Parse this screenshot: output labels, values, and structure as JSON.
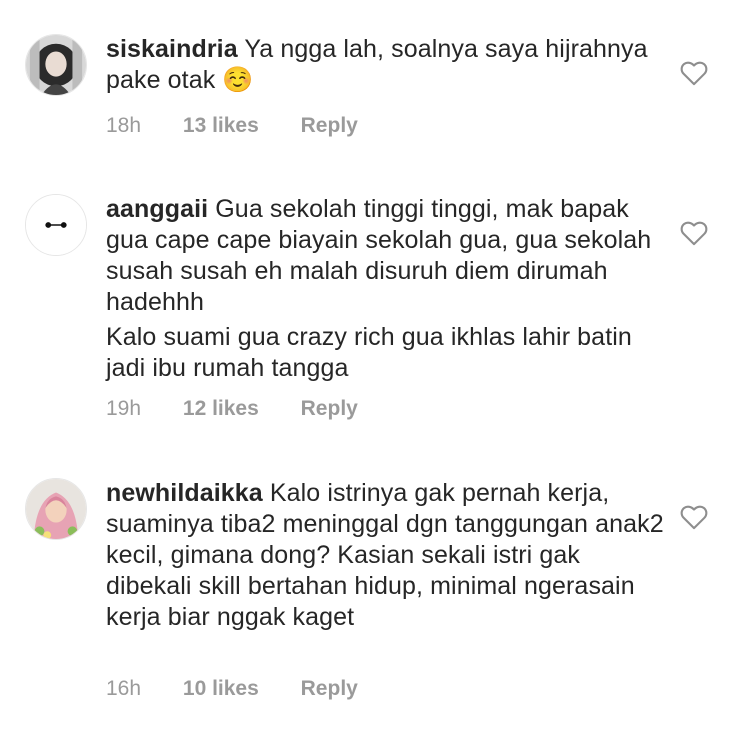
{
  "comments": [
    {
      "username": "siskaindria",
      "lines": [
        "Ya ngga lah, soalnya saya hijrahnya pake otak ☺️"
      ],
      "time": "18h",
      "likes": "13 likes",
      "reply": "Reply"
    },
    {
      "username": "aanggaii",
      "lines": [
        "Gua sekolah tinggi tinggi, mak bapak gua cape cape biayain sekolah gua, gua sekolah susah susah eh malah disuruh diem dirumah hadehhh",
        "Kalo suami gua crazy rich gua ikhlas lahir batin jadi ibu rumah tangga"
      ],
      "time": "19h",
      "likes": "12 likes",
      "reply": "Reply"
    },
    {
      "username": "newhildaikka",
      "lines": [
        "Kalo istrinya gak pernah kerja, suaminya tiba2 meninggal dgn tanggungan anak2 kecil, gimana dong? Kasian sekali istri gak dibekali skill bertahan hidup, minimal ngerasain kerja biar nggak kaget"
      ],
      "time": "16h",
      "likes": "10 likes",
      "reply": "Reply"
    }
  ],
  "icons": {
    "like": "heart-outline-icon"
  },
  "colors": {
    "text": "#262626",
    "meta": "#9a9a9a"
  }
}
